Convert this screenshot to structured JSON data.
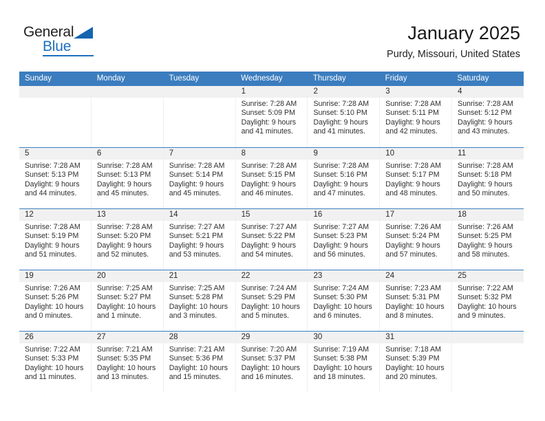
{
  "brand": {
    "name_top": "General",
    "name_bottom": "Blue"
  },
  "header": {
    "title": "January 2025",
    "subtitle": "Purdy, Missouri, United States"
  },
  "colors": {
    "header_blue": "#3b7dbf",
    "brand_blue": "#1d6fc0",
    "day_number_band": "#f1f1f1",
    "cell_divider": "#eceff1"
  },
  "calendar": {
    "weekdays": [
      "Sunday",
      "Monday",
      "Tuesday",
      "Wednesday",
      "Thursday",
      "Friday",
      "Saturday"
    ],
    "labels": {
      "sunrise": "Sunrise:",
      "sunset": "Sunset:",
      "daylight": "Daylight:"
    },
    "weeks": [
      [
        {
          "day": "",
          "empty": true
        },
        {
          "day": "",
          "empty": true
        },
        {
          "day": "",
          "empty": true
        },
        {
          "day": "1",
          "sunrise": "Sunrise: 7:28 AM",
          "sunset": "Sunset: 5:09 PM",
          "daylight_line1": "Daylight: 9 hours",
          "daylight_line2": "and 41 minutes."
        },
        {
          "day": "2",
          "sunrise": "Sunrise: 7:28 AM",
          "sunset": "Sunset: 5:10 PM",
          "daylight_line1": "Daylight: 9 hours",
          "daylight_line2": "and 41 minutes."
        },
        {
          "day": "3",
          "sunrise": "Sunrise: 7:28 AM",
          "sunset": "Sunset: 5:11 PM",
          "daylight_line1": "Daylight: 9 hours",
          "daylight_line2": "and 42 minutes."
        },
        {
          "day": "4",
          "sunrise": "Sunrise: 7:28 AM",
          "sunset": "Sunset: 5:12 PM",
          "daylight_line1": "Daylight: 9 hours",
          "daylight_line2": "and 43 minutes."
        }
      ],
      [
        {
          "day": "5",
          "sunrise": "Sunrise: 7:28 AM",
          "sunset": "Sunset: 5:13 PM",
          "daylight_line1": "Daylight: 9 hours",
          "daylight_line2": "and 44 minutes."
        },
        {
          "day": "6",
          "sunrise": "Sunrise: 7:28 AM",
          "sunset": "Sunset: 5:13 PM",
          "daylight_line1": "Daylight: 9 hours",
          "daylight_line2": "and 45 minutes."
        },
        {
          "day": "7",
          "sunrise": "Sunrise: 7:28 AM",
          "sunset": "Sunset: 5:14 PM",
          "daylight_line1": "Daylight: 9 hours",
          "daylight_line2": "and 45 minutes."
        },
        {
          "day": "8",
          "sunrise": "Sunrise: 7:28 AM",
          "sunset": "Sunset: 5:15 PM",
          "daylight_line1": "Daylight: 9 hours",
          "daylight_line2": "and 46 minutes."
        },
        {
          "day": "9",
          "sunrise": "Sunrise: 7:28 AM",
          "sunset": "Sunset: 5:16 PM",
          "daylight_line1": "Daylight: 9 hours",
          "daylight_line2": "and 47 minutes."
        },
        {
          "day": "10",
          "sunrise": "Sunrise: 7:28 AM",
          "sunset": "Sunset: 5:17 PM",
          "daylight_line1": "Daylight: 9 hours",
          "daylight_line2": "and 48 minutes."
        },
        {
          "day": "11",
          "sunrise": "Sunrise: 7:28 AM",
          "sunset": "Sunset: 5:18 PM",
          "daylight_line1": "Daylight: 9 hours",
          "daylight_line2": "and 50 minutes."
        }
      ],
      [
        {
          "day": "12",
          "sunrise": "Sunrise: 7:28 AM",
          "sunset": "Sunset: 5:19 PM",
          "daylight_line1": "Daylight: 9 hours",
          "daylight_line2": "and 51 minutes."
        },
        {
          "day": "13",
          "sunrise": "Sunrise: 7:28 AM",
          "sunset": "Sunset: 5:20 PM",
          "daylight_line1": "Daylight: 9 hours",
          "daylight_line2": "and 52 minutes."
        },
        {
          "day": "14",
          "sunrise": "Sunrise: 7:27 AM",
          "sunset": "Sunset: 5:21 PM",
          "daylight_line1": "Daylight: 9 hours",
          "daylight_line2": "and 53 minutes."
        },
        {
          "day": "15",
          "sunrise": "Sunrise: 7:27 AM",
          "sunset": "Sunset: 5:22 PM",
          "daylight_line1": "Daylight: 9 hours",
          "daylight_line2": "and 54 minutes."
        },
        {
          "day": "16",
          "sunrise": "Sunrise: 7:27 AM",
          "sunset": "Sunset: 5:23 PM",
          "daylight_line1": "Daylight: 9 hours",
          "daylight_line2": "and 56 minutes."
        },
        {
          "day": "17",
          "sunrise": "Sunrise: 7:26 AM",
          "sunset": "Sunset: 5:24 PM",
          "daylight_line1": "Daylight: 9 hours",
          "daylight_line2": "and 57 minutes."
        },
        {
          "day": "18",
          "sunrise": "Sunrise: 7:26 AM",
          "sunset": "Sunset: 5:25 PM",
          "daylight_line1": "Daylight: 9 hours",
          "daylight_line2": "and 58 minutes."
        }
      ],
      [
        {
          "day": "19",
          "sunrise": "Sunrise: 7:26 AM",
          "sunset": "Sunset: 5:26 PM",
          "daylight_line1": "Daylight: 10 hours",
          "daylight_line2": "and 0 minutes."
        },
        {
          "day": "20",
          "sunrise": "Sunrise: 7:25 AM",
          "sunset": "Sunset: 5:27 PM",
          "daylight_line1": "Daylight: 10 hours",
          "daylight_line2": "and 1 minute."
        },
        {
          "day": "21",
          "sunrise": "Sunrise: 7:25 AM",
          "sunset": "Sunset: 5:28 PM",
          "daylight_line1": "Daylight: 10 hours",
          "daylight_line2": "and 3 minutes."
        },
        {
          "day": "22",
          "sunrise": "Sunrise: 7:24 AM",
          "sunset": "Sunset: 5:29 PM",
          "daylight_line1": "Daylight: 10 hours",
          "daylight_line2": "and 5 minutes."
        },
        {
          "day": "23",
          "sunrise": "Sunrise: 7:24 AM",
          "sunset": "Sunset: 5:30 PM",
          "daylight_line1": "Daylight: 10 hours",
          "daylight_line2": "and 6 minutes."
        },
        {
          "day": "24",
          "sunrise": "Sunrise: 7:23 AM",
          "sunset": "Sunset: 5:31 PM",
          "daylight_line1": "Daylight: 10 hours",
          "daylight_line2": "and 8 minutes."
        },
        {
          "day": "25",
          "sunrise": "Sunrise: 7:22 AM",
          "sunset": "Sunset: 5:32 PM",
          "daylight_line1": "Daylight: 10 hours",
          "daylight_line2": "and 9 minutes."
        }
      ],
      [
        {
          "day": "26",
          "sunrise": "Sunrise: 7:22 AM",
          "sunset": "Sunset: 5:33 PM",
          "daylight_line1": "Daylight: 10 hours",
          "daylight_line2": "and 11 minutes."
        },
        {
          "day": "27",
          "sunrise": "Sunrise: 7:21 AM",
          "sunset": "Sunset: 5:35 PM",
          "daylight_line1": "Daylight: 10 hours",
          "daylight_line2": "and 13 minutes."
        },
        {
          "day": "28",
          "sunrise": "Sunrise: 7:21 AM",
          "sunset": "Sunset: 5:36 PM",
          "daylight_line1": "Daylight: 10 hours",
          "daylight_line2": "and 15 minutes."
        },
        {
          "day": "29",
          "sunrise": "Sunrise: 7:20 AM",
          "sunset": "Sunset: 5:37 PM",
          "daylight_line1": "Daylight: 10 hours",
          "daylight_line2": "and 16 minutes."
        },
        {
          "day": "30",
          "sunrise": "Sunrise: 7:19 AM",
          "sunset": "Sunset: 5:38 PM",
          "daylight_line1": "Daylight: 10 hours",
          "daylight_line2": "and 18 minutes."
        },
        {
          "day": "31",
          "sunrise": "Sunrise: 7:18 AM",
          "sunset": "Sunset: 5:39 PM",
          "daylight_line1": "Daylight: 10 hours",
          "daylight_line2": "and 20 minutes."
        },
        {
          "day": "",
          "empty": true
        }
      ]
    ]
  }
}
